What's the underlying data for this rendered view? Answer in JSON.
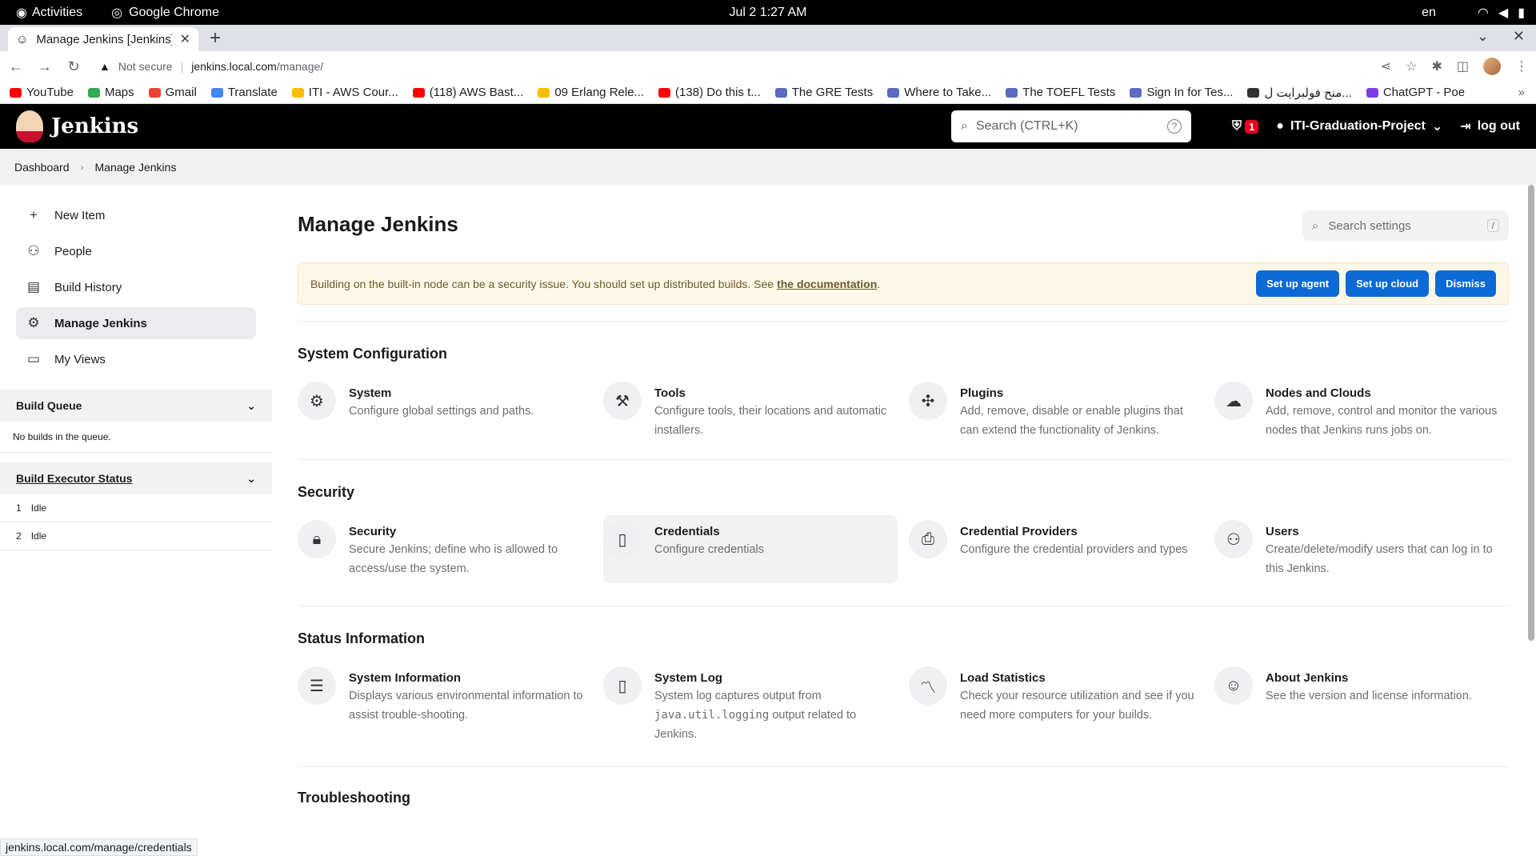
{
  "gnome": {
    "activities": "Activities",
    "app": "Google Chrome",
    "clock": "Jul 2  1:27 AM",
    "lang": "en"
  },
  "chrome": {
    "tab_title": "Manage Jenkins [Jenkins]",
    "security_label": "Not secure",
    "url_host": "jenkins.local.com",
    "url_path": "/manage/",
    "bookmarks": [
      {
        "label": "YouTube",
        "color": "#ff0000"
      },
      {
        "label": "Maps",
        "color": "#34a853"
      },
      {
        "label": "Gmail",
        "color": "#ea4335"
      },
      {
        "label": "Translate",
        "color": "#4285f4"
      },
      {
        "label": "ITI - AWS Cour...",
        "color": "#fbbc04"
      },
      {
        "label": "(118) AWS Bast...",
        "color": "#ff0000"
      },
      {
        "label": "09 Erlang Rele...",
        "color": "#fbbc04"
      },
      {
        "label": "(138) Do this t...",
        "color": "#ff0000"
      },
      {
        "label": "The GRE Tests",
        "color": "#5b6bbf"
      },
      {
        "label": "Where to Take...",
        "color": "#5b6bbf"
      },
      {
        "label": "The TOEFL Tests",
        "color": "#5b6bbf"
      },
      {
        "label": "Sign In for Tes...",
        "color": "#5b6bbf"
      },
      {
        "label": "منح فولبرايت ل...",
        "color": "#333333"
      },
      {
        "label": "ChatGPT - Poe",
        "color": "#7b3fe4"
      }
    ]
  },
  "jenkins": {
    "brand": "Jenkins",
    "search_placeholder": "Search (CTRL+K)",
    "security_count": "1",
    "user": "ITI-Graduation-Project",
    "logout": "log out",
    "breadcrumb": [
      "Dashboard",
      "Manage Jenkins"
    ]
  },
  "sidebar": {
    "items": [
      {
        "label": "New Item",
        "icon": "plus-icon"
      },
      {
        "label": "People",
        "icon": "people-icon"
      },
      {
        "label": "Build History",
        "icon": "history-icon"
      },
      {
        "label": "Manage Jenkins",
        "icon": "gear-icon"
      },
      {
        "label": "My Views",
        "icon": "window-icon"
      }
    ],
    "build_queue": {
      "title": "Build Queue",
      "empty": "No builds in the queue."
    },
    "executors": {
      "title": "Build Executor Status",
      "rows": [
        {
          "num": "1",
          "state": "Idle"
        },
        {
          "num": "2",
          "state": "Idle"
        }
      ]
    }
  },
  "page": {
    "title": "Manage Jenkins",
    "settings_search_placeholder": "Search settings",
    "settings_search_key": "/",
    "alert": {
      "text": "Building on the built-in node can be a security issue. You should set up distributed builds. See",
      "link": "the documentation",
      "suffix": ".",
      "buttons": [
        "Set up agent",
        "Set up cloud",
        "Dismiss"
      ]
    },
    "sections": [
      {
        "title": "System Configuration",
        "items": [
          {
            "name": "System",
            "desc": "Configure global settings and paths."
          },
          {
            "name": "Tools",
            "desc": "Configure tools, their locations and automatic installers."
          },
          {
            "name": "Plugins",
            "desc": "Add, remove, disable or enable plugins that can extend the functionality of Jenkins."
          },
          {
            "name": "Nodes and Clouds",
            "desc": "Add, remove, control and monitor the various nodes that Jenkins runs jobs on."
          }
        ]
      },
      {
        "title": "Security",
        "items": [
          {
            "name": "Security",
            "desc": "Secure Jenkins; define who is allowed to access/use the system."
          },
          {
            "name": "Credentials",
            "desc": "Configure credentials"
          },
          {
            "name": "Credential Providers",
            "desc": "Configure the credential providers and types"
          },
          {
            "name": "Users",
            "desc": "Create/delete/modify users that can log in to this Jenkins."
          }
        ]
      },
      {
        "title": "Status Information",
        "items": [
          {
            "name": "System Information",
            "desc": "Displays various environmental information to assist trouble-shooting."
          },
          {
            "name": "System Log",
            "desc_pre": "System log captures output from",
            "desc_code": "java.util.logging",
            "desc_post": "output related to Jenkins."
          },
          {
            "name": "Load Statistics",
            "desc": "Check your resource utilization and see if you need more computers for your builds."
          },
          {
            "name": "About Jenkins",
            "desc": "See the version and license information."
          }
        ]
      },
      {
        "title": "Troubleshooting"
      }
    ]
  },
  "status_url": "jenkins.local.com/manage/credentials"
}
